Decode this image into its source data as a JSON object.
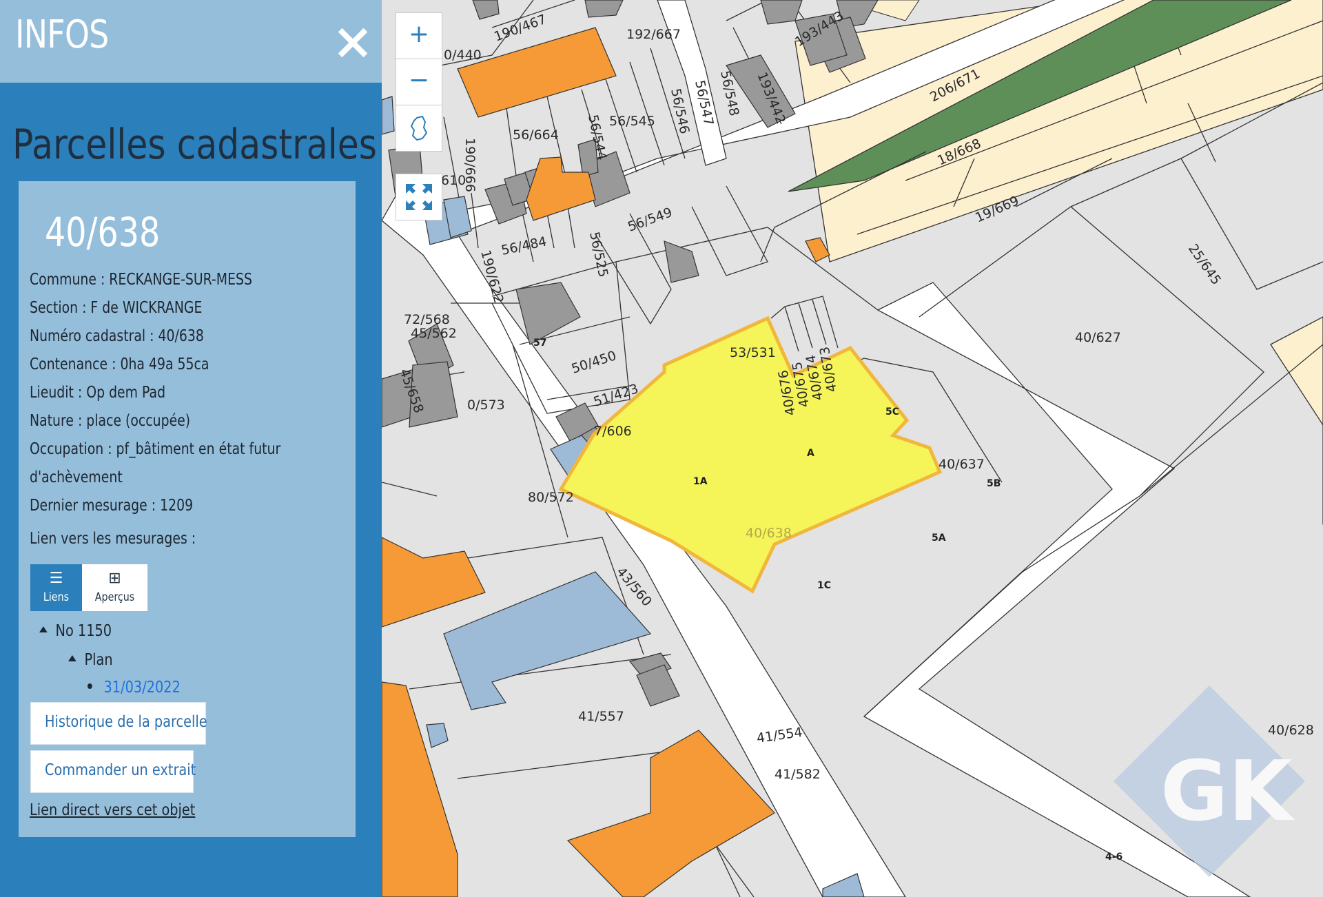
{
  "panel": {
    "title": "INFOS",
    "section_title": "Parcelles cadastrales",
    "parcel_id": "40/638",
    "attributes": [
      "Commune : RECKANGE-SUR-MESS",
      "Section : F de WICKRANGE",
      "Numéro cadastral : 40/638",
      "Contenance : 0ha 49a 55ca",
      "Lieudit : Op dem Pad",
      "Nature : place (occupée)",
      "Occupation : pf_bâtiment en état futur",
      "d'achèvement",
      "Dernier mesurage : 1209",
      "Lien vers les mesurages :"
    ],
    "tabs": {
      "liens": "Liens",
      "apercus": "Aperçus"
    },
    "tree": {
      "level1": "No 1150",
      "level2": "Plan",
      "date": "31/03/2022"
    },
    "buttons": {
      "history": "Historique de la parcelle",
      "order": "Commander un extrait",
      "direct_link": "Lien direct vers cet objet"
    }
  },
  "map_controls": {
    "zoom_in": "+",
    "zoom_out": "−"
  },
  "map": {
    "parcel_labels": [
      "190/467",
      "192/667",
      "0/440",
      "193/443",
      "56/664",
      "56/545",
      "56/546",
      "56/547",
      "56/548",
      "193/442",
      "206/671",
      "18/668",
      "19/669",
      "190/666",
      "56/544",
      "610",
      "56/549",
      "56/484",
      "56/525",
      "190/622",
      "25/645",
      "72/568",
      "45/562",
      "53/531",
      "40/627",
      "50/450",
      "45/658",
      "0/573",
      "51/423",
      "40/673",
      "40/674",
      "40/675",
      "40/676",
      "7/606",
      "40/637",
      "80/572",
      "40/638",
      "43/560",
      "41/557",
      "41/554",
      "41/582",
      "40/628"
    ],
    "house_numbers": [
      "1A",
      "1C",
      "5A",
      "5B",
      "5C",
      "4-6",
      "57",
      "A"
    ],
    "watermark": "GK"
  },
  "colors": {
    "panel_bg": "#2b7fbb",
    "panel_header": "#95bedb",
    "selected_parcel": "#f5f55a",
    "building_orange": "#f59a36",
    "building_grey": "#999999",
    "building_blue": "#9dbad6",
    "agricultural": "#fdf0cf",
    "forest": "#5f8f59"
  }
}
